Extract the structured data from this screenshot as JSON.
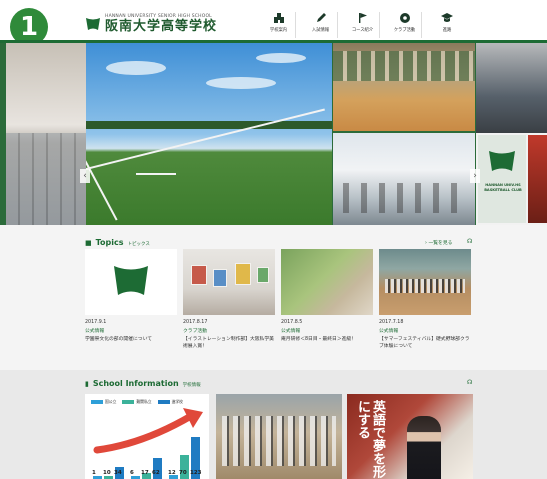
{
  "badge": "1",
  "header": {
    "logo_sub": "HANNAN UNIVERSITY SENIOR HIGH SCHOOL",
    "logo_main": "阪南大学高等学校",
    "nav": [
      {
        "label": "学校案内",
        "icon": "school-building-icon"
      },
      {
        "label": "入試情報",
        "icon": "pen-icon"
      },
      {
        "label": "コース紹介",
        "icon": "flag-icon"
      },
      {
        "label": "クラブ活動",
        "icon": "soccer-ball-icon"
      },
      {
        "label": "進路",
        "icon": "graduation-cap-icon"
      }
    ]
  },
  "hero": {
    "basketball_text": "HANNAN UNIV.HS BASKETBALL CLUB",
    "slides": 7,
    "active_slide": 6
  },
  "topics": {
    "title": "Topics",
    "subtitle": "トピックス",
    "more": "一覧を見る",
    "items": [
      {
        "date": "2017.9.1",
        "category": "公式情報",
        "text": "学園祭文化の部の開催について"
      },
      {
        "date": "2017.8.17",
        "category": "クラブ活動",
        "text": "【イラストレーション制作部】大阪私学美術展入賞！"
      },
      {
        "date": "2017.8.5",
        "category": "公式情報",
        "text": "庵月研修＜8日目・最終日＞進級！"
      },
      {
        "date": "2017.7.18",
        "category": "公式情報",
        "text": "【サマーフェスティバル】硬式野球部クラブ体験について"
      }
    ]
  },
  "info": {
    "title": "School Information",
    "subtitle": "学校情報",
    "chart_legend": [
      {
        "label": "国公立",
        "color": "#2e9fd8"
      },
      {
        "label": "難関私立",
        "color": "#3bb29a"
      },
      {
        "label": "進学校",
        "color": "#1f7bc2"
      }
    ],
    "chart_bars": [
      {
        "label": "1",
        "value": 1,
        "color": "#2e9fd8"
      },
      {
        "label": "10",
        "value": 10,
        "color": "#3bb29a"
      },
      {
        "label": "34",
        "value": 34,
        "color": "#1f7bc2"
      },
      {
        "label": "6",
        "value": 6,
        "color": "#2e9fd8"
      },
      {
        "label": "17",
        "value": 17,
        "color": "#3bb29a"
      },
      {
        "label": "62",
        "value": 62,
        "color": "#1f7bc2"
      },
      {
        "label": "12",
        "value": 12,
        "color": "#2e9fd8"
      },
      {
        "label": "70",
        "value": 70,
        "color": "#3bb29a"
      },
      {
        "label": "123",
        "value": 123,
        "color": "#1f7bc2"
      }
    ],
    "cover_text": "英語で夢を形にする"
  }
}
